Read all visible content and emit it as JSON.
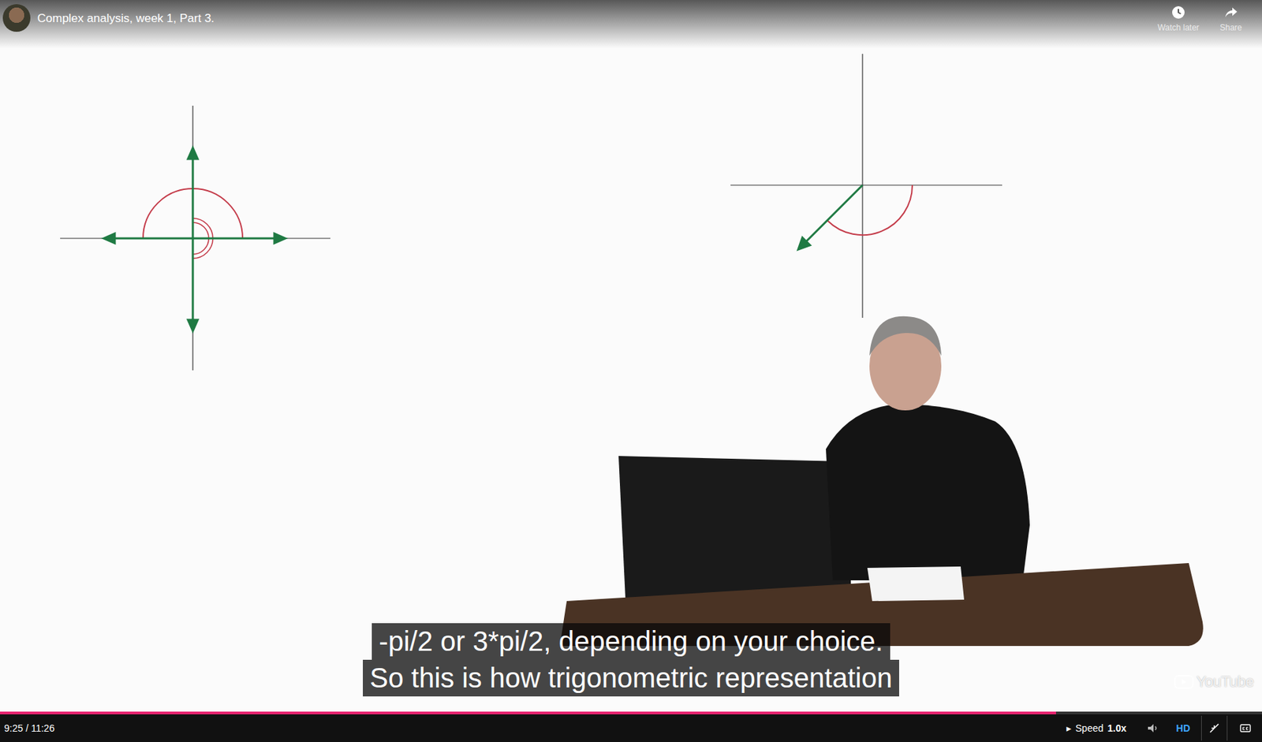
{
  "player": {
    "title": "Complex analysis, week 1, Part 3.",
    "actions": [
      {
        "label": "Watch later",
        "icon": "clock"
      },
      {
        "label": "Share",
        "icon": "share"
      }
    ],
    "captions": [
      "-pi/2 or 3*pi/2, depending on your choice.",
      "So this is how trigonometric representation"
    ],
    "watermark": "YouTube",
    "progress": {
      "level": 0.837
    },
    "time": "9:25 / 11:26",
    "speed": {
      "arrow": "▸",
      "label": "Speed",
      "value": "1.0x"
    },
    "quality": "HD"
  }
}
